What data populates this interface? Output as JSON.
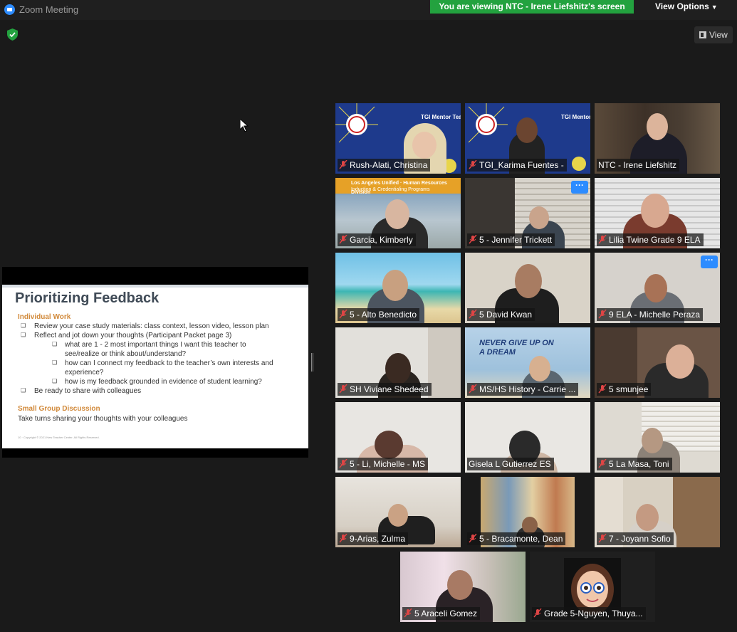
{
  "window": {
    "title": "Zoom Meeting"
  },
  "banner": {
    "viewing": "You are viewing NTC - Irene Liefshitz's screen",
    "view_options": "View Options"
  },
  "toolbar": {
    "view_label": "View"
  },
  "slide": {
    "title": "Prioritizing Feedback",
    "section1": "Individual Work",
    "items": [
      "Review your case study materials: class context, lesson video, lesson plan",
      "Reflect and jot down your thoughts (Participant Packet page 3)",
      "what are 1 - 2 most important things I want this teacher to",
      "see/realize or think about/understand?",
      "how can I connect my feedback to the teacher’s own interests and",
      "experience?",
      "how is my feedback grounded in evidence of student learning?",
      "Be ready to share with colleagues"
    ],
    "section2": "Small Group Discussion",
    "closing": "Take turns sharing your thoughts with your colleagues",
    "footer": "10 · Copyright © 2021 New Teacher Center. All Rights Reserved."
  },
  "participants": [
    {
      "name": "Rush-Alati, Christina",
      "muted": true
    },
    {
      "name": "TGI_Karima Fuentes -",
      "muted": true
    },
    {
      "name": "NTC - Irene Liefshitz",
      "muted": false,
      "active_speaker": true
    },
    {
      "name": "Garcia, Kimberly",
      "muted": true
    },
    {
      "name": "5 - Jennifer Trickett",
      "muted": true,
      "menu": "···"
    },
    {
      "name": "Lilia Twine Grade 9 ELA",
      "muted": true
    },
    {
      "name": "5 - Alto Benedicto",
      "muted": true
    },
    {
      "name": "5 David Kwan",
      "muted": true
    },
    {
      "name": "9 ELA - Michelle Peraza",
      "muted": true,
      "menu": "···"
    },
    {
      "name": "SH Viviane Shedeed",
      "muted": true
    },
    {
      "name": "MS/HS History - Carrie ...",
      "muted": true
    },
    {
      "name": "5 smunjee",
      "muted": true
    },
    {
      "name": "5 - Li, Michelle - MS",
      "muted": true
    },
    {
      "name": "Gisela L Gutierrez ES",
      "muted": false
    },
    {
      "name": "5 La Masa, Toni",
      "muted": true
    },
    {
      "name": "9-Arias, Zulma",
      "muted": true
    },
    {
      "name": "5 - Bracamonte, Dean",
      "muted": true
    },
    {
      "name": "7 - Joyann Sofio",
      "muted": true
    },
    {
      "name": "5 Araceli Gomez",
      "muted": true
    },
    {
      "name": "Grade 5-Nguyen, Thuya...",
      "muted": true
    }
  ],
  "tile_text": {
    "mentor_team": "TGI Mentor Team",
    "lausd_header": "Los Angeles Unified · Human Resources Division",
    "lausd_sub": "Induction & Credentialing Programs",
    "never_give_up": "NEVER GIVE UP ON A DREAM"
  },
  "colors": {
    "banner_green": "#23a23f",
    "accent_blue": "#2d8cff",
    "active_outline": "#c5e16a",
    "muted_red": "#e04545",
    "slide_heading": "#3f4a56",
    "slide_orange": "#d1893a"
  }
}
